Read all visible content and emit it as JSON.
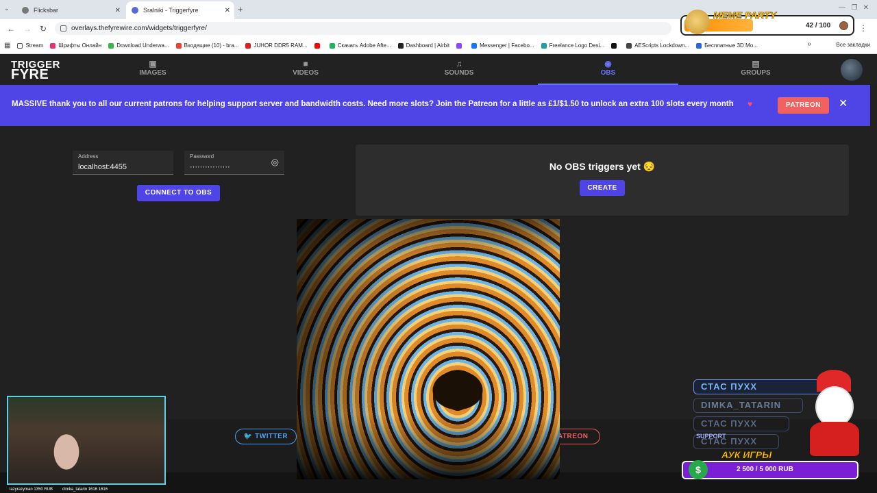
{
  "browser": {
    "tabs": [
      {
        "title": "Flicksbar"
      },
      {
        "title": "Sralniki - Triggerfyre"
      }
    ],
    "url": "overlays.thefyrewire.com/widgets/triggerfyre/",
    "bookmarks": [
      "Stream",
      "Шрифты Онлайн",
      "Download Underwa...",
      "Входящие (10) - bra...",
      "JUHOR DDR5 RAM...",
      "Скачать Adobe Afte...",
      "Dashboard | Airbit",
      "Messenger | Facebo...",
      "Freelance Logo Desi...",
      "AEScripts Lockdown...",
      "Бесплатные 3D Мо..."
    ],
    "all_bookmarks": "Все закладки"
  },
  "app": {
    "logo_line1": "TRIGGER",
    "logo_line2": "FYRE",
    "nav": {
      "images": "IMAGES",
      "videos": "VIDEOS",
      "sounds": "SOUNDS",
      "obs": "OBS",
      "groups": "GROUPS"
    },
    "banner": {
      "text": "MASSIVE thank you to all our current patrons for helping support server and bandwidth costs. Need more slots? Join the Patreon for a little as £1/$1.50 to unlock an extra 100 slots every month",
      "button": "PATREON"
    },
    "form": {
      "address_label": "Address",
      "address_value": "localhost:4455",
      "password_label": "Password",
      "password_value": "················",
      "connect_button": "CONNECT TO OBS"
    },
    "triggers": {
      "empty_text": "No OBS triggers yet 😔",
      "create_button": "CREATE"
    },
    "footer": {
      "twitter": "TWITTER",
      "patreon": "PATREON"
    }
  },
  "overlays": {
    "meme_party": {
      "title": "MEME PARTY",
      "count": "42 / 100",
      "progress": 0.42
    },
    "webcam_caption": [
      "lazyrazyman 1350 RUB",
      "dimka_tatarin 1616 1616"
    ],
    "chat": [
      "СТАС ПУХХ",
      "DIMKA_TATARIN",
      "СТАС ПУХХ",
      "СТАС ПУХХ"
    ],
    "support_label": "SUPPORT",
    "auction": {
      "title": "АУК ИГРЫ",
      "value": "2 500 / 5 000 RUB"
    }
  }
}
